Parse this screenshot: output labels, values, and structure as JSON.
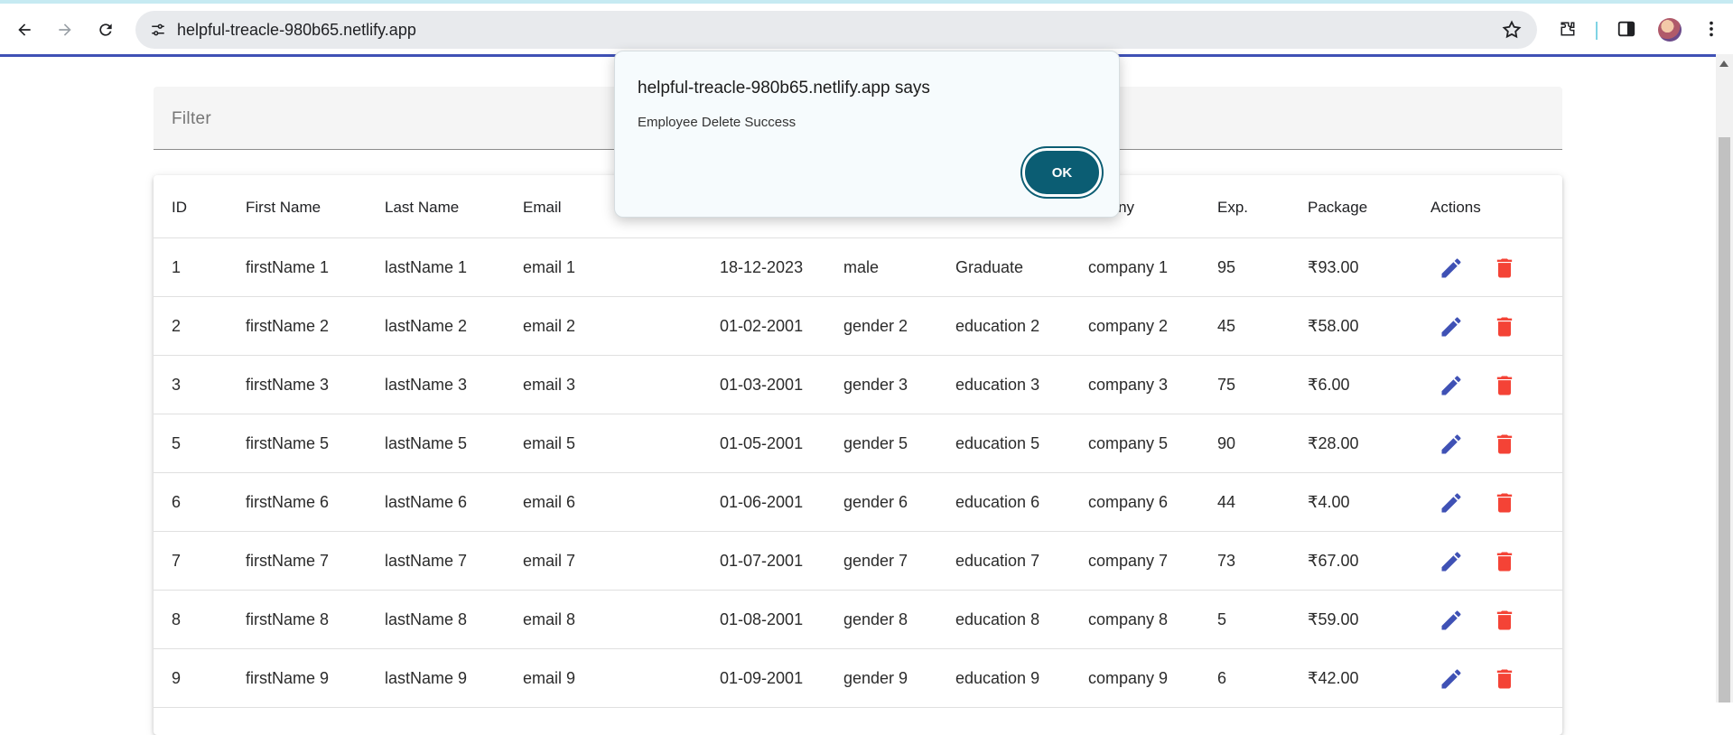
{
  "browser": {
    "url": "helpful-treacle-980b65.netlify.app"
  },
  "filter": {
    "placeholder": "Filter"
  },
  "table": {
    "headers": [
      "ID",
      "First Name",
      "Last Name",
      "Email",
      "",
      "",
      "",
      "mpany",
      "Exp.",
      "Package",
      "Actions"
    ],
    "rows": [
      [
        "1",
        "firstName 1",
        "lastName 1",
        "email 1",
        "18-12-2023",
        "male",
        "Graduate",
        "company 1",
        "95",
        "₹93.00"
      ],
      [
        "2",
        "firstName 2",
        "lastName 2",
        "email 2",
        "01-02-2001",
        "gender 2",
        "education 2",
        "company 2",
        "45",
        "₹58.00"
      ],
      [
        "3",
        "firstName 3",
        "lastName 3",
        "email 3",
        "01-03-2001",
        "gender 3",
        "education 3",
        "company 3",
        "75",
        "₹6.00"
      ],
      [
        "5",
        "firstName 5",
        "lastName 5",
        "email 5",
        "01-05-2001",
        "gender 5",
        "education 5",
        "company 5",
        "90",
        "₹28.00"
      ],
      [
        "6",
        "firstName 6",
        "lastName 6",
        "email 6",
        "01-06-2001",
        "gender 6",
        "education 6",
        "company 6",
        "44",
        "₹4.00"
      ],
      [
        "7",
        "firstName 7",
        "lastName 7",
        "email 7",
        "01-07-2001",
        "gender 7",
        "education 7",
        "company 7",
        "73",
        "₹67.00"
      ],
      [
        "8",
        "firstName 8",
        "lastName 8",
        "email 8",
        "01-08-2001",
        "gender 8",
        "education 8",
        "company 8",
        "5",
        "₹59.00"
      ],
      [
        "9",
        "firstName 9",
        "lastName 9",
        "email 9",
        "01-09-2001",
        "gender 9",
        "education 9",
        "company 9",
        "6",
        "₹42.00"
      ]
    ],
    "actions": {
      "edit_icon": "edit-icon",
      "delete_icon": "delete-icon"
    }
  },
  "dialog": {
    "title": "helpful-treacle-980b65.netlify.app says",
    "message": "Employee Delete Success",
    "ok_label": "OK"
  },
  "colors": {
    "accent": "#3f51b5",
    "delete": "#f44336",
    "ok_button": "#0b5d73"
  }
}
